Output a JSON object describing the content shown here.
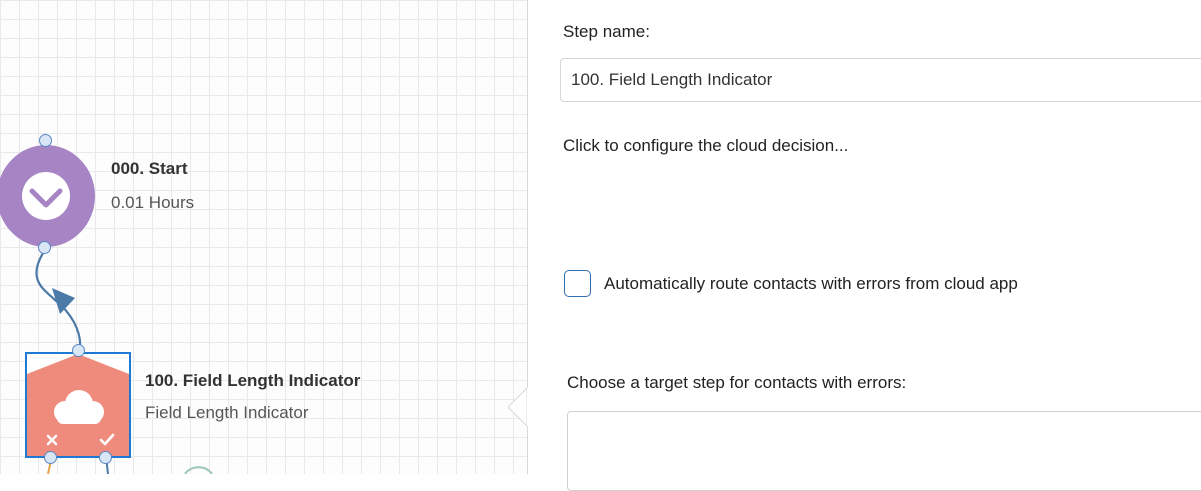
{
  "canvas": {
    "start_node": {
      "title": "000. Start",
      "subtitle": "0.01 Hours",
      "icon": "clock-icon",
      "color": "#a784c4"
    },
    "decision_node": {
      "title": "100. Field Length Indicator",
      "subtitle": "Field Length Indicator",
      "icon": "cloud-icon",
      "color": "#ef8b7c",
      "selected_border_color": "#1e79d2",
      "outcome_icons": [
        "x-icon",
        "check-icon"
      ]
    },
    "connector_color": "#4b7aa8"
  },
  "panel": {
    "step_name_label": "Step name:",
    "step_name_value": "100. Field Length Indicator",
    "configure_link": "Click to configure the cloud decision...",
    "auto_route_label": "Automatically route contacts with errors from cloud app",
    "auto_route_checked": false,
    "target_step_label": "Choose a target step for contacts with errors:",
    "target_step_value": ""
  }
}
